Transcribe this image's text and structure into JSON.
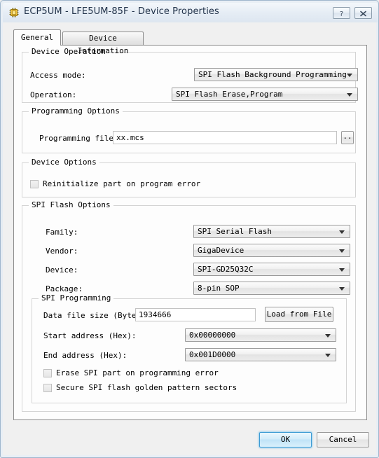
{
  "window": {
    "title": "ECP5UM - LFE5UM-85F - Device Properties",
    "icon": "chip-icon",
    "help_button": "?",
    "close_button": "✕"
  },
  "tabs": [
    {
      "label": "General",
      "active": true
    },
    {
      "label": "Device Information",
      "active": false
    }
  ],
  "device_operation": {
    "group_label": "Device Operation",
    "access_mode_label": "Access mode:",
    "access_mode_value": "SPI Flash Background Programming",
    "operation_label": "Operation:",
    "operation_value": "SPI Flash Erase,Program"
  },
  "programming_options": {
    "group_label": "Programming Options",
    "file_label": "Programming file:",
    "file_value": "xx.mcs",
    "browse_label": ".."
  },
  "device_options": {
    "group_label": "Device Options",
    "reinit_label": "Reinitialize part on program error",
    "reinit_checked": false
  },
  "spi_flash_options": {
    "group_label": "SPI Flash Options",
    "family_label": "Family:",
    "family_value": "SPI Serial Flash",
    "vendor_label": "Vendor:",
    "vendor_value": "GigaDevice",
    "device_label": "Device:",
    "device_value": "SPI-GD25Q32C",
    "package_label": "Package:",
    "package_value": "8-pin SOP"
  },
  "spi_programming": {
    "group_label": "SPI Programming",
    "data_file_size_label": "Data file size (Bytes):",
    "data_file_size_value": "1934666",
    "load_from_file_label": "Load from File",
    "start_address_label": "Start address (Hex):",
    "start_address_value": "0x00000000",
    "end_address_label": "End address (Hex):",
    "end_address_value": "0x001D0000",
    "erase_on_error_label": "Erase SPI part on programming error",
    "erase_on_error_checked": false,
    "secure_golden_label": "Secure SPI flash golden pattern sectors",
    "secure_golden_checked": false
  },
  "footer": {
    "ok_label": "OK",
    "cancel_label": "Cancel"
  },
  "colors": {
    "accent": "#3c9bd4",
    "window_bg": "#f0f0f0",
    "page_bg": "#fdfdfd",
    "title_text": "#23344b"
  }
}
